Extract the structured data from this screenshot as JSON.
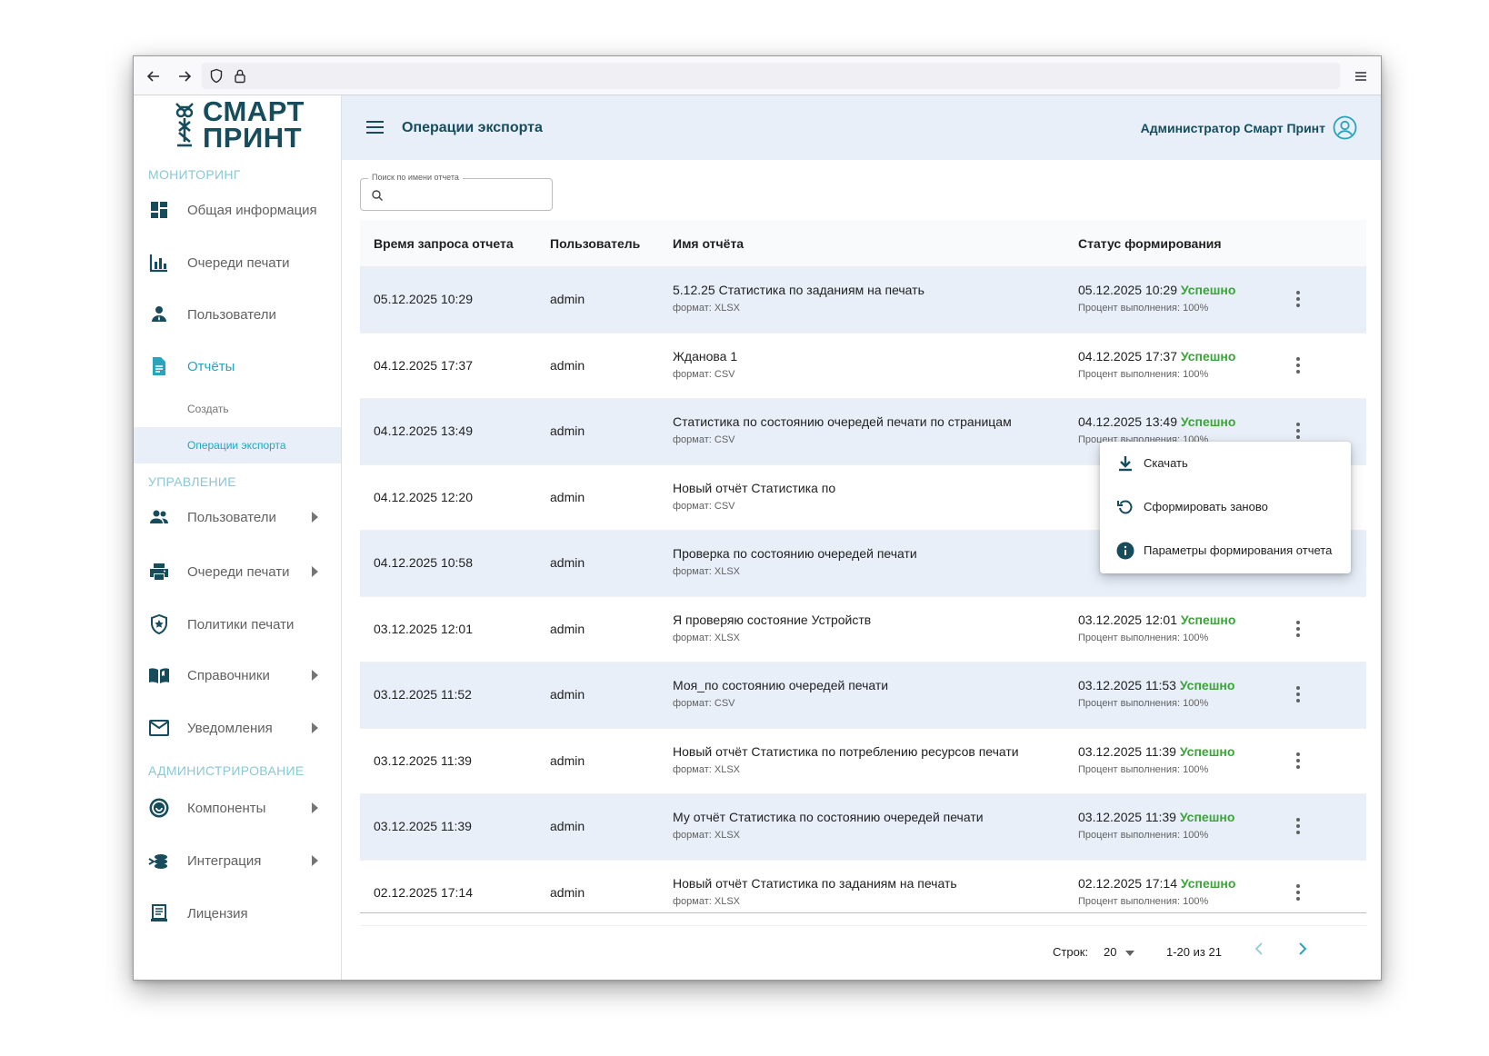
{
  "app": {
    "logo_line1": "СМАРТ",
    "logo_line2": "ПРИНТ",
    "page_title": "Операции экспорта",
    "user_name": "Администратор Смарт Принт"
  },
  "sidebar": {
    "sections": {
      "monitoring": "МОНИТОРИНГ",
      "management": "УПРАВЛЕНИЕ",
      "administration": "АДМИНИСТРИРОВАНИЕ"
    },
    "monitoring_items": [
      {
        "label": "Общая информация",
        "icon": "dashboard-icon"
      },
      {
        "label": "Очереди печати",
        "icon": "bar-chart-icon"
      },
      {
        "label": "Пользователи",
        "icon": "user-icon"
      },
      {
        "label": "Отчёты",
        "icon": "report-icon"
      }
    ],
    "report_subitems": [
      {
        "label": "Создать"
      },
      {
        "label": "Операции экспорта"
      }
    ],
    "management_items": [
      {
        "label": "Пользователи",
        "icon": "users-icon"
      },
      {
        "label": "Очереди печати",
        "icon": "printer-icon"
      },
      {
        "label": "Политики печати",
        "icon": "shield-icon"
      },
      {
        "label": "Справочники",
        "icon": "book-icon"
      },
      {
        "label": "Уведомления",
        "icon": "mail-icon"
      }
    ],
    "administration_items": [
      {
        "label": "Компоненты",
        "icon": "components-icon"
      },
      {
        "label": "Интеграция",
        "icon": "integration-icon"
      },
      {
        "label": "Лицензия",
        "icon": "license-icon"
      }
    ]
  },
  "search": {
    "label": "Поиск по имени отчета",
    "value": ""
  },
  "table": {
    "columns": [
      "Время запроса отчета",
      "Пользователь",
      "Имя отчёта",
      "Статус формирования"
    ],
    "rows": [
      {
        "time": "05.12.2025 10:29",
        "user": "admin",
        "name": "5.12.25 Статистика по заданиям на печать",
        "format": "формат: XLSX",
        "status_time": "05.12.2025 10:29",
        "status": "Успешно",
        "progress": "Процент выполнения: 100%"
      },
      {
        "time": "04.12.2025 17:37",
        "user": "admin",
        "name": "Жданова 1",
        "format": "формат: CSV",
        "status_time": "04.12.2025 17:37",
        "status": "Успешно",
        "progress": "Процент выполнения: 100%"
      },
      {
        "time": "04.12.2025 13:49",
        "user": "admin",
        "name": "Статистика по состоянию очередей печати по страницам",
        "format": "формат: CSV",
        "status_time": "04.12.2025 13:49",
        "status": "Успешно",
        "progress": "Процент выполнения: 100%"
      },
      {
        "time": "04.12.2025 12:20",
        "user": "admin",
        "name": "Новый отчёт Статистика по",
        "format": "формат: CSV",
        "status_time": "",
        "status": "",
        "progress": ""
      },
      {
        "time": "04.12.2025 10:58",
        "user": "admin",
        "name": "Проверка по состоянию очередей печати",
        "format": "формат: XLSX",
        "status_time": "",
        "status": "",
        "progress": ""
      },
      {
        "time": "03.12.2025 12:01",
        "user": "admin",
        "name": "Я проверяю состояние Устройств",
        "format": "формат: XLSX",
        "status_time": "03.12.2025 12:01",
        "status": "Успешно",
        "progress": "Процент выполнения: 100%"
      },
      {
        "time": "03.12.2025 11:52",
        "user": "admin",
        "name": "Моя_по состоянию очередей печати",
        "format": "формат: CSV",
        "status_time": "03.12.2025 11:53",
        "status": "Успешно",
        "progress": "Процент выполнения: 100%"
      },
      {
        "time": "03.12.2025 11:39",
        "user": "admin",
        "name": "Новый отчёт Статистика по потреблению ресурсов печати",
        "format": "формат: XLSX",
        "status_time": "03.12.2025 11:39",
        "status": "Успешно",
        "progress": "Процент выполнения: 100%"
      },
      {
        "time": "03.12.2025 11:39",
        "user": "admin",
        "name": "Му отчёт Статистика по состоянию очередей печати",
        "format": "формат: XLSX",
        "status_time": "03.12.2025 11:39",
        "status": "Успешно",
        "progress": "Процент выполнения: 100%"
      },
      {
        "time": "02.12.2025 17:14",
        "user": "admin",
        "name": "Новый отчёт Статистика по заданиям на печать",
        "format": "формат: XLSX",
        "status_time": "02.12.2025 17:14",
        "status": "Успешно",
        "progress": "Процент выполнения: 100%"
      }
    ]
  },
  "context_menu": {
    "items": [
      {
        "label": "Скачать",
        "icon": "download-icon"
      },
      {
        "label": "Сформировать заново",
        "icon": "refresh-icon"
      },
      {
        "label": "Параметры формирования отчета",
        "icon": "info-icon"
      }
    ]
  },
  "pagination": {
    "rows_label": "Строк:",
    "rows_value": "20",
    "range": "1-20 из 21"
  },
  "colors": {
    "brand": "#164c5c",
    "accent": "#2aa3bb",
    "success": "#3aa437",
    "row_shade": "#e8eff9"
  }
}
